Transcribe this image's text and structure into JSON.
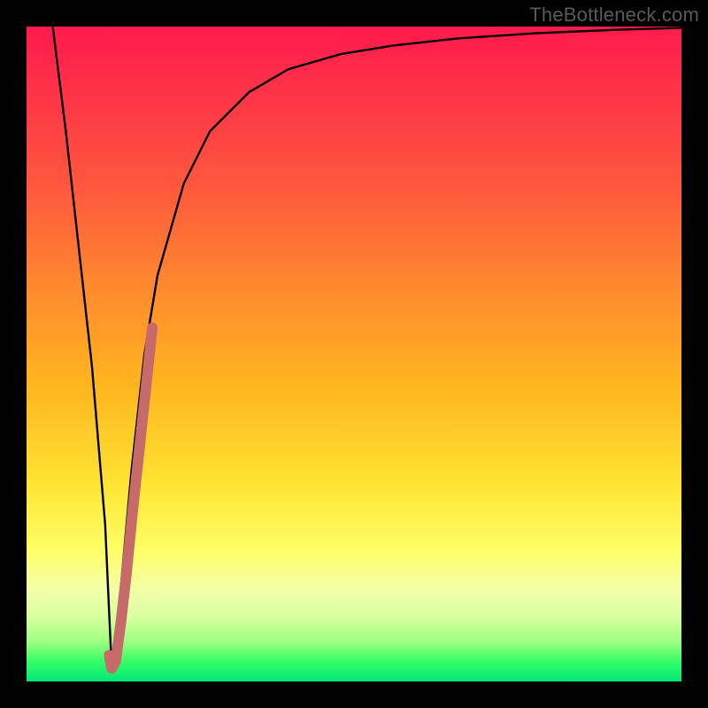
{
  "watermark": "TheBottleneck.com",
  "chart_data": {
    "type": "line",
    "title": "",
    "xlabel": "",
    "ylabel": "",
    "xlim": [
      0,
      100
    ],
    "ylim": [
      0,
      100
    ],
    "series": [
      {
        "name": "bottleneck-curve",
        "x": [
          4,
          6,
          8,
          10,
          12,
          13,
          14,
          16,
          18,
          20,
          24,
          28,
          34,
          40,
          48,
          56,
          66,
          78,
          90,
          100
        ],
        "values": [
          100,
          84,
          66,
          48,
          24,
          2,
          10,
          32,
          50,
          62,
          76,
          84,
          90,
          93.5,
          95.8,
          97.1,
          98.2,
          99,
          99.5,
          99.8
        ]
      },
      {
        "name": "highlight-segment",
        "x": [
          12.6,
          13,
          13.6,
          14.4,
          15.2,
          16.2,
          17.6,
          19.2
        ],
        "values": [
          4,
          2,
          3,
          9,
          16,
          26,
          39,
          54
        ]
      }
    ],
    "gradient_stops": [
      {
        "pos": 0,
        "color": "#ff1a4d"
      },
      {
        "pos": 25,
        "color": "#ff593d"
      },
      {
        "pos": 55,
        "color": "#ffb61e"
      },
      {
        "pos": 80,
        "color": "#ffff66"
      },
      {
        "pos": 100,
        "color": "#00e676"
      }
    ],
    "highlight_color": "#c76a6a",
    "curve_color": "#000000"
  }
}
